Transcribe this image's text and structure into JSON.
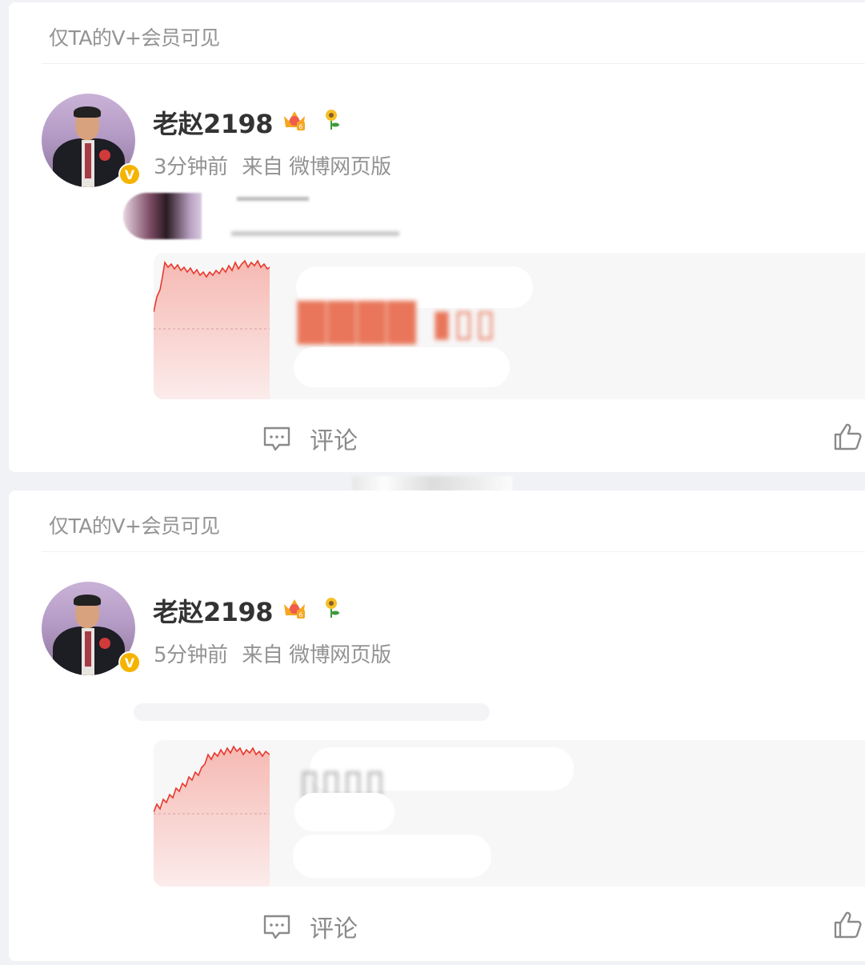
{
  "posts": [
    {
      "visibility": "仅TA的V+会员可见",
      "username": "老赵2198",
      "time": "3分钟前",
      "source": "来自 微博网页版",
      "comment_label": "评论",
      "colors": {
        "chart_line": "#e8382d",
        "badge": "#f5b400"
      }
    },
    {
      "visibility": "仅TA的V+会员可见",
      "username": "老赵2198",
      "time": "5分钟前",
      "source": "来自 微博网页版",
      "comment_label": "评论",
      "colors": {
        "chart_line": "#e8382d",
        "badge": "#f5b400"
      }
    }
  ],
  "icons": {
    "verified": "verified-v-icon",
    "member": "crown-member-icon",
    "fan": "sunflower-icon",
    "comment": "comment-icon",
    "like": "thumbs-up-icon"
  }
}
